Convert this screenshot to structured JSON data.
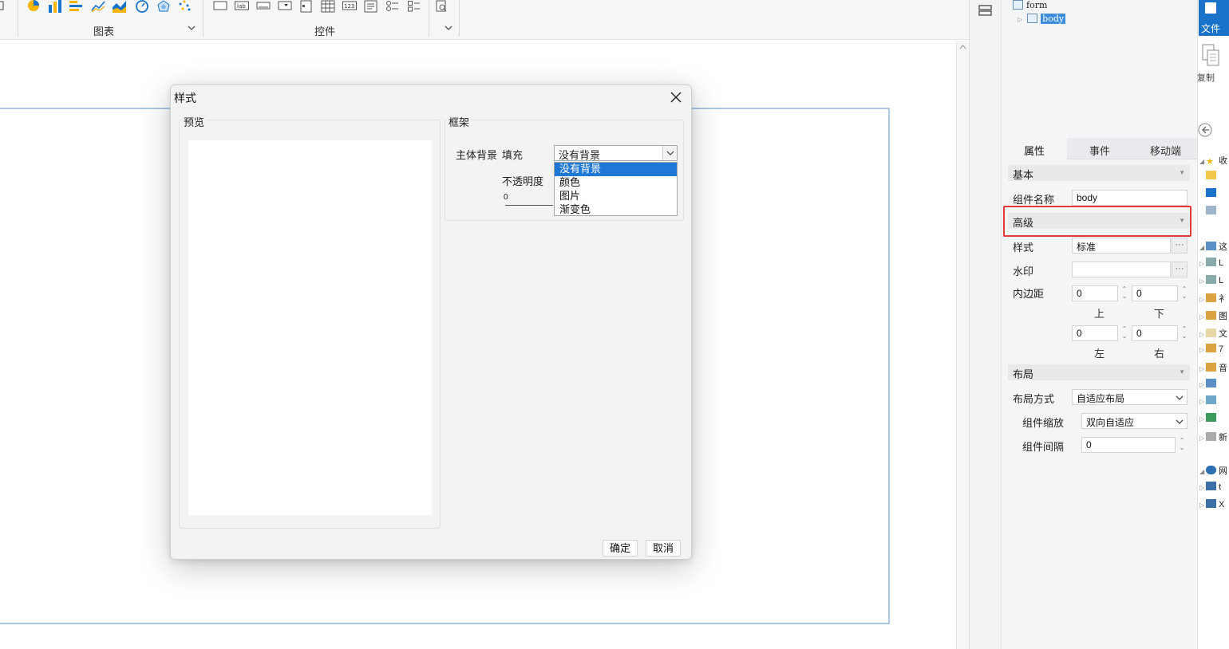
{
  "ribbon": {
    "groups": [
      {
        "label": "图表",
        "chevron": "⌄"
      },
      {
        "label": "控件",
        "chevron": "⌄"
      }
    ],
    "chart_icons": [
      "pie-chart-icon",
      "column-chart-icon",
      "bar-chart-icon",
      "line-chart-icon",
      "area-chart-icon",
      "gauge-chart-icon",
      "radar-chart-icon",
      "scatter-chart-icon"
    ],
    "control_icons": [
      "frame-control-icon",
      "label-control-icon",
      "textbox-control-icon",
      "dropdown-control-icon",
      "date-control-icon",
      "grid-control-icon",
      "number-control-icon",
      "textarea-control-icon",
      "radio-group-control-icon",
      "checkbox-group-control-icon",
      "preview-icon"
    ],
    "number_icon_text": "123",
    "label_icon_text": "lab"
  },
  "tree": {
    "root_label": "form",
    "child_label": "body"
  },
  "panel": {
    "tabs": [
      "属性",
      "事件",
      "移动端"
    ],
    "basic": {
      "header": "基本",
      "component_name_label": "组件名称",
      "component_name_value": "body"
    },
    "advanced": {
      "header": "高级",
      "style_label": "样式",
      "style_value": "标准",
      "watermark_label": "水印",
      "watermark_value": "",
      "ellipsis": "···",
      "padding_label": "内边距",
      "padding_top": "0",
      "padding_bottom": "0",
      "padding_left": "0",
      "padding_right": "0",
      "top_label": "上",
      "bottom_label": "下",
      "left_label": "左",
      "right_label": "右"
    },
    "layout": {
      "header": "布局",
      "mode_label": "布局方式",
      "mode_value": "自适应布局",
      "scale_label": "组件缩放",
      "scale_value": "双向自适应",
      "gap_label": "组件间隔",
      "gap_value": "0"
    }
  },
  "explorer": {
    "file_tab": "文件",
    "copy_label": "复制",
    "rows": [
      "收",
      "",
      "",
      "",
      "这",
      "L",
      "L",
      "衤",
      "图",
      "文",
      "7",
      "音",
      "",
      "",
      "",
      "新",
      "网",
      "t",
      "X"
    ]
  },
  "dialog": {
    "title": "样式",
    "preview_legend": "预览",
    "frame_legend": "框架",
    "body_bg_label": "主体背景",
    "fill_label": "填充",
    "fill_value": "没有背景",
    "fill_options": [
      "没有背景",
      "颜色",
      "图片",
      "渐变色"
    ],
    "selected_option_index": 0,
    "opacity_label": "不透明度",
    "opacity_value": "0",
    "ok_label": "确定",
    "cancel_label": "取消"
  },
  "colors": {
    "accent": "#1f78d6",
    "highlight": "#e53935",
    "form_border": "#a9c9e6",
    "file_tab": "#1a73c9"
  }
}
